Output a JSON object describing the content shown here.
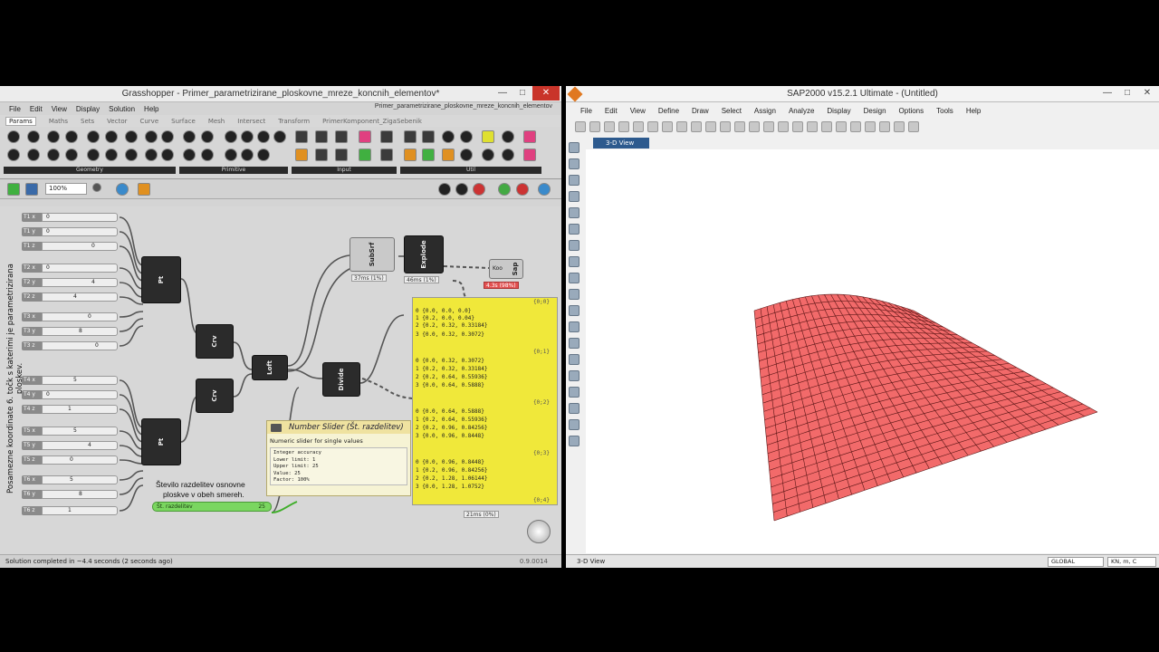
{
  "grasshopper": {
    "title": "Grasshopper - Primer_parametrizirane_ploskovne_mreze_koncnih_elementov*",
    "file_label": "Primer_parametrizirane_ploskovne_mreze_koncnih_elementov",
    "window_buttons": [
      "—",
      "□",
      "✕"
    ],
    "menu": [
      "File",
      "Edit",
      "View",
      "Display",
      "Solution",
      "Help"
    ],
    "tabs": [
      "Params",
      "Maths",
      "Sets",
      "Vector",
      "Curve",
      "Surface",
      "Mesh",
      "Intersect",
      "Transform",
      "PrimerKomponent_ZigaSebenik"
    ],
    "ribbon_groups": [
      "Geometry",
      "Primitive",
      "Input",
      "Util"
    ],
    "zoom": "100%",
    "vertical_label": "Posamezne koordinate 6. točk s katerimi je parametrizirana ploskev.",
    "params": [
      {
        "label": "T1 x",
        "value": "0"
      },
      {
        "label": "T1 y",
        "value": "0"
      },
      {
        "label": "T1 z",
        "value": "0"
      },
      {
        "label": "T2 x",
        "value": "0"
      },
      {
        "label": "T2 y",
        "value": "4"
      },
      {
        "label": "T2 z",
        "value": "4"
      },
      {
        "label": "T3 x",
        "value": "0"
      },
      {
        "label": "T3 y",
        "value": "8"
      },
      {
        "label": "T3 z",
        "value": "0"
      },
      {
        "label": "T4 x",
        "value": "5"
      },
      {
        "label": "T4 y",
        "value": "0"
      },
      {
        "label": "T4 z",
        "value": "1"
      },
      {
        "label": "T5 x",
        "value": "5"
      },
      {
        "label": "T5 y",
        "value": "4"
      },
      {
        "label": "T5 z",
        "value": "0"
      },
      {
        "label": "T6 x",
        "value": "5"
      },
      {
        "label": "T6 y",
        "value": "8"
      },
      {
        "label": "T6 z",
        "value": "1"
      }
    ],
    "nodes": {
      "pt1": "Pt",
      "pt2": "Pt",
      "crv1": "Crv",
      "crv2": "Crv",
      "loft": "Loft",
      "divide": "Divide",
      "subsrf": "SubSrf",
      "explode": "Explode",
      "sap": "Sap",
      "koo": "Koo"
    },
    "timings": {
      "subsrf": "37ms (1%)",
      "explode": "46ms (1%)",
      "sap": "4.3s (98%)",
      "panel": "21ms (0%)"
    },
    "panel": {
      "branches": [
        {
          "header": "{0;0}",
          "lines": [
            "0 {0.0, 0.0, 0.0}",
            "1 {0.2, 0.0, 0.04}",
            "2 {0.2, 0.32, 0.33184}",
            "3 {0.0, 0.32, 0.3072}"
          ]
        },
        {
          "header": "{0;1}",
          "lines": [
            "0 {0.0, 0.32, 0.3072}",
            "1 {0.2, 0.32, 0.33184}",
            "2 {0.2, 0.64, 0.55936}",
            "3 {0.0, 0.64, 0.5888}"
          ]
        },
        {
          "header": "{0;2}",
          "lines": [
            "0 {0.0, 0.64, 0.5888}",
            "1 {0.2, 0.64, 0.55936}",
            "2 {0.2, 0.96, 0.84256}",
            "3 {0.0, 0.96, 0.8448}"
          ]
        },
        {
          "header": "{0;3}",
          "lines": [
            "0 {0.0, 0.96, 0.8448}",
            "1 {0.2, 0.96, 0.84256}",
            "2 {0.2, 1.28, 1.06144}",
            "3 {0.0, 1.28, 1.0752}"
          ]
        }
      ],
      "last_header": "{0;4}"
    },
    "tooltip": {
      "title": "Number Slider (Št. razdelitev)",
      "subtitle": "Numeric slider for single values",
      "lines": [
        "Integer accuracy",
        "Lower limit: 1",
        "Upper limit: 25",
        "Value: 25",
        "Factor: 100%"
      ]
    },
    "description": [
      "Število razdelitev osnovne",
      "ploskve v obeh smereh."
    ],
    "slider": {
      "label": "Št. razdelitev",
      "value": "25"
    },
    "status": "Solution completed in ~4.4 seconds (2 seconds ago)",
    "version": "0.9.0014"
  },
  "sap": {
    "title": "SAP2000 v15.2.1 Ultimate  - (Untitled)",
    "window_buttons": [
      "—",
      "□",
      "✕"
    ],
    "menu": [
      "File",
      "Edit",
      "View",
      "Define",
      "Draw",
      "Select",
      "Assign",
      "Analyze",
      "Display",
      "Design",
      "Options",
      "Tools",
      "Help"
    ],
    "view_tab": "3-D View",
    "status": "3-D View",
    "coord_system": "GLOBAL",
    "units": "KN, m, C",
    "surface_color": "#f26a6a",
    "grid_divisions": 25
  }
}
